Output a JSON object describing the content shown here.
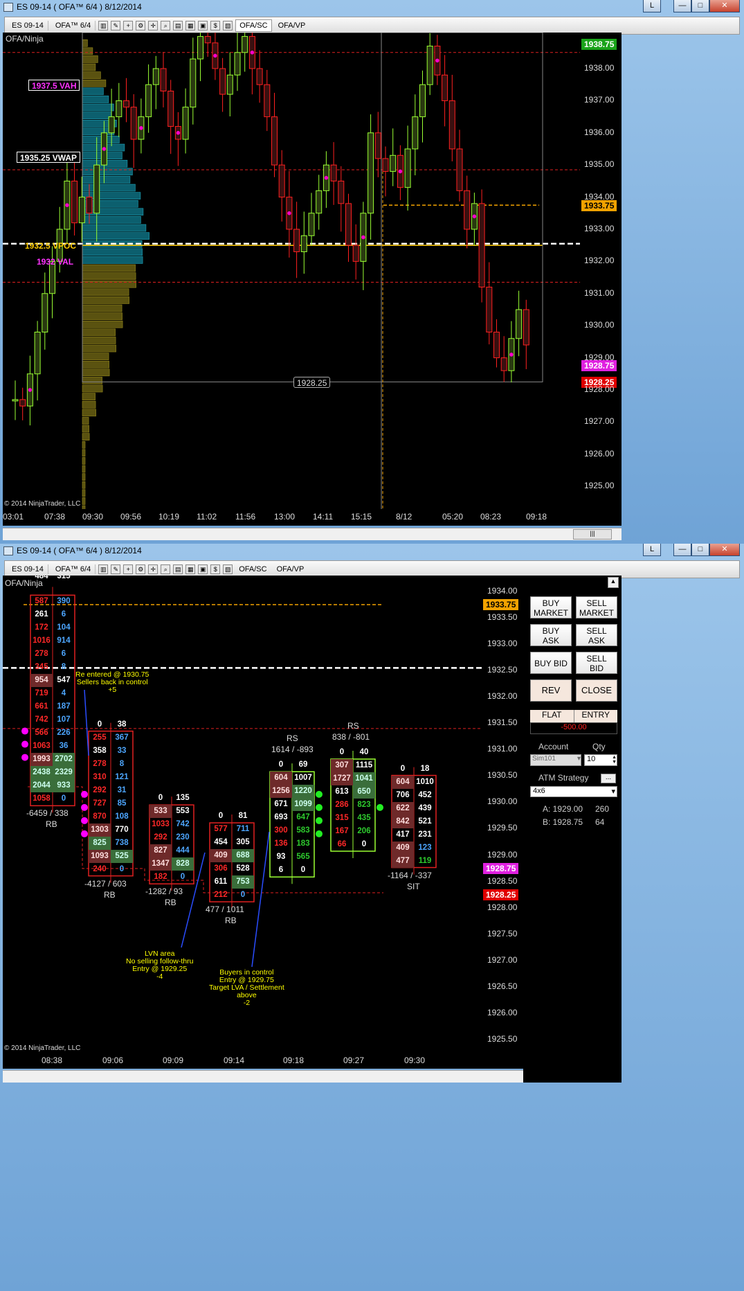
{
  "window_top": {
    "title": "ES 09-14 ( OFA™ 6/4 )  8/12/2014",
    "controls": [
      "L",
      "—",
      "□",
      "✕"
    ]
  },
  "window_bottom": {
    "title": "ES 09-14 ( OFA™ 6/4 )  8/12/2014",
    "controls": [
      "L",
      "—",
      "□",
      "✕"
    ]
  },
  "toolbar": {
    "instrument": "ES 09-14",
    "template": "OFA™ 6/4",
    "tab1": "OFA/SC",
    "tab2": "OFA/VP"
  },
  "top_chart": {
    "title": "OFA/Ninja",
    "copyright": "© 2014 NinjaTrader, LLC",
    "y_ticks": [
      "1938.00",
      "1937.00",
      "1936.00",
      "1935.00",
      "1934.00",
      "1933.00",
      "1932.00",
      "1931.00",
      "1930.00",
      "1929.00",
      "1928.00",
      "1927.00",
      "1926.00",
      "1925.00"
    ],
    "x_ticks": [
      "03:01",
      "07:38",
      "09:30",
      "09:56",
      "10:19",
      "11:02",
      "11:56",
      "13:00",
      "14:11",
      "15:15",
      "8/12",
      "05:20",
      "08:23",
      "09:18"
    ],
    "vah_label": "1937.5 VAH",
    "vwap_label": "1935.25 VWAP",
    "vpoc_label": "1932.5 VPOC",
    "val_label": "1932 VAL",
    "range_low_label": "1928.25",
    "price_tags": {
      "green": "1938.75",
      "orange": "1933.75",
      "magenta": "1928.75",
      "red": "1928.25"
    }
  },
  "bottom_chart": {
    "title": "OFA/Ninja",
    "copyright": "© 2014 NinjaTrader, LLC",
    "y_ticks": [
      "1934.00",
      "1933.50",
      "1933.00",
      "1932.50",
      "1932.00",
      "1931.50",
      "1931.00",
      "1930.50",
      "1930.00",
      "1929.50",
      "1929.00",
      "1928.50",
      "1928.00",
      "1927.50",
      "1927.00",
      "1926.50",
      "1926.00",
      "1925.50"
    ],
    "x_ticks": [
      "08:38",
      "09:06",
      "09:09",
      "09:14",
      "09:18",
      "09:27",
      "09:30"
    ],
    "price_tags": {
      "orange": "1933.75",
      "magenta": "1928.75",
      "red": "1928.25"
    },
    "bar1": {
      "top_partial": [
        [
          "484",
          "315"
        ]
      ],
      "rows": [
        [
          "587",
          "390"
        ],
        [
          "261",
          "6"
        ],
        [
          "172",
          "104"
        ],
        [
          "1016",
          "914"
        ],
        [
          "278",
          "6"
        ],
        [
          "345",
          "8"
        ],
        [
          "954",
          "547"
        ],
        [
          "719",
          "4"
        ],
        [
          "661",
          "187"
        ],
        [
          "742",
          "107"
        ],
        [
          "566",
          "226"
        ],
        [
          "1063",
          "36"
        ],
        [
          "1993",
          "2702"
        ],
        [
          "2438",
          "2329"
        ],
        [
          "2044",
          "933"
        ],
        [
          "1058",
          "0"
        ]
      ],
      "delta": "-6459 / 338",
      "label": "RB"
    },
    "bar2": {
      "rows": [
        [
          "0",
          "38"
        ],
        [
          "255",
          "367"
        ],
        [
          "358",
          "33"
        ],
        [
          "278",
          "8"
        ],
        [
          "310",
          "121"
        ],
        [
          "292",
          "31"
        ],
        [
          "727",
          "85"
        ],
        [
          "870",
          "108"
        ],
        [
          "1303",
          "770"
        ],
        [
          "825",
          "738"
        ],
        [
          "1093",
          "525"
        ],
        [
          "240",
          "0"
        ]
      ],
      "delta": "-4127 / 603",
      "label": "RB"
    },
    "bar3": {
      "rows": [
        [
          "0",
          "135"
        ],
        [
          "533",
          "553"
        ],
        [
          "1033",
          "742"
        ],
        [
          "292",
          "230"
        ],
        [
          "827",
          "444"
        ],
        [
          "1347",
          "828"
        ],
        [
          "182",
          "0"
        ]
      ],
      "delta": "-1282 / 93",
      "label": "RB"
    },
    "bar4": {
      "rows": [
        [
          "0",
          "81"
        ],
        [
          "577",
          "711"
        ],
        [
          "454",
          "305"
        ],
        [
          "409",
          "688"
        ],
        [
          "306",
          "528"
        ],
        [
          "611",
          "753"
        ],
        [
          "212",
          "0"
        ]
      ],
      "delta": "477 / 1011",
      "label": "RB"
    },
    "bar5": {
      "header": "RS",
      "sub": "1614 / -893",
      "rows": [
        [
          "0",
          "69"
        ],
        [
          "604",
          "1007"
        ],
        [
          "1256",
          "1220"
        ],
        [
          "671",
          "1099"
        ],
        [
          "693",
          "647"
        ],
        [
          "300",
          "583"
        ],
        [
          "136",
          "183"
        ],
        [
          "93",
          "565"
        ],
        [
          "6",
          "0"
        ]
      ]
    },
    "bar6": {
      "header": "RS",
      "sub": "838 / -801",
      "rows": [
        [
          "0",
          "40"
        ],
        [
          "307",
          "1115"
        ],
        [
          "1727",
          "1041"
        ],
        [
          "613",
          "650"
        ],
        [
          "286",
          "823"
        ],
        [
          "315",
          "435"
        ],
        [
          "167",
          "206"
        ],
        [
          "66",
          "0"
        ]
      ]
    },
    "bar7": {
      "rows": [
        [
          "0",
          "18"
        ],
        [
          "604",
          "1010"
        ],
        [
          "706",
          "452"
        ],
        [
          "622",
          "439"
        ],
        [
          "842",
          "521"
        ],
        [
          "417",
          "231"
        ],
        [
          "409",
          "123"
        ],
        [
          "477",
          "119"
        ]
      ],
      "delta": "-1164 / -337",
      "label": "SIT"
    },
    "notes": {
      "n1": "Re entered @ 1930.75\nSellers back in control\n+5",
      "n2": "LVN area\nNo selling follow-thru\nEntry @ 1929.25\n-4",
      "n3": "Buyers in control\nEntry @ 1929.75\nTarget LVA / Settlement\nabove\n-2"
    }
  },
  "order_panel": {
    "buy_market": "BUY\nMARKET",
    "sell_market": "SELL\nMARKET",
    "buy_ask": "BUY\nASK",
    "sell_ask": "SELL\nASK",
    "buy_bid": "BUY BID",
    "sell_bid": "SELL\nBID",
    "rev": "REV",
    "close": "CLOSE",
    "flat": "FLAT",
    "entry": "ENTRY",
    "pnl": "-500.00",
    "account_label": "Account",
    "qty_label": "Qty",
    "account": "Sim101",
    "qty": "10",
    "atm_label": "ATM Strategy",
    "atm_btn": "...",
    "atm_value": "4x6",
    "ask_line": "A: 1929.00",
    "ask_size": "260",
    "bid_line": "B: 1928.75",
    "bid_size": "64"
  }
}
